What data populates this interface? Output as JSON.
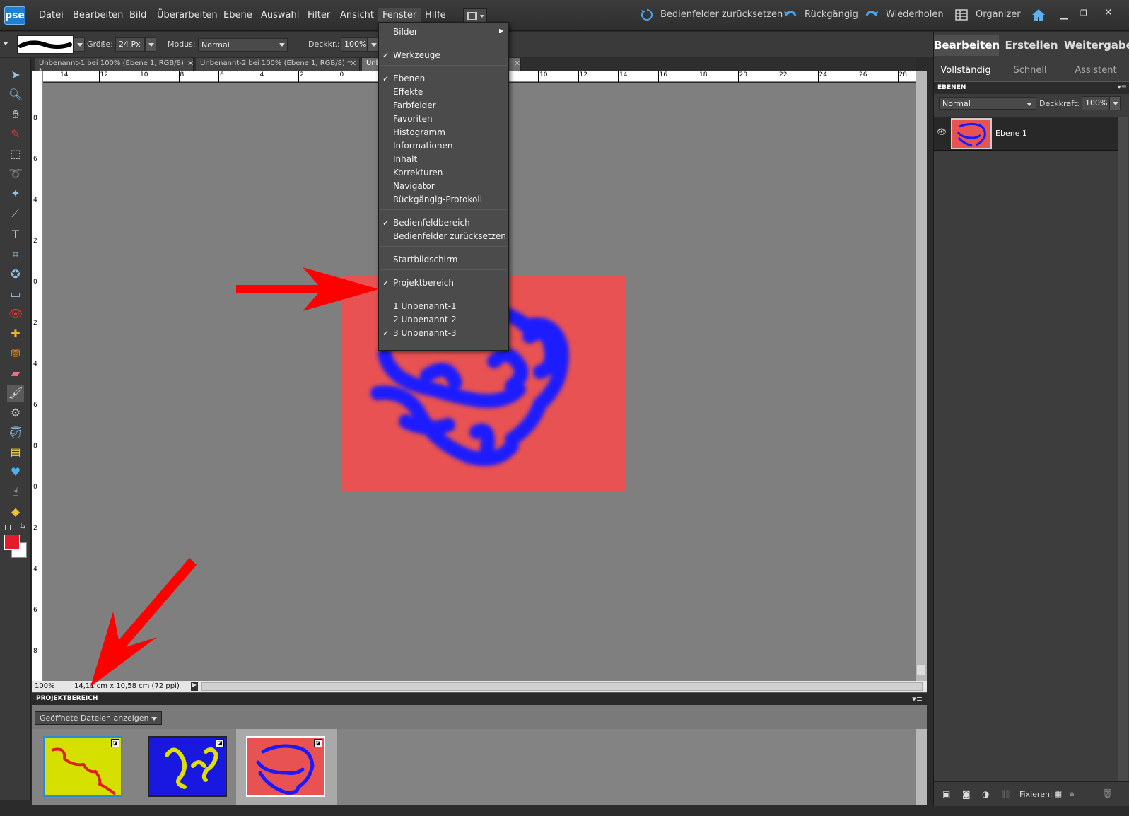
{
  "app": {
    "logo_text": "pse"
  },
  "menubar": {
    "items": [
      "Datei",
      "Bearbeiten",
      "Bild",
      "Überarbeiten",
      "Ebene",
      "Auswahl",
      "Filter",
      "Ansicht",
      "Fenster",
      "Hilfe"
    ],
    "active": "Fenster",
    "reset_panels": "Bedienfelder zurücksetzen",
    "undo": "Rückgängig",
    "redo": "Wiederholen",
    "organizer": "Organizer"
  },
  "options": {
    "size_label": "Größe:",
    "size_value": "24 Px",
    "mode_label": "Modus:",
    "mode_value": "Normal",
    "opacity_label": "Deckkr.:",
    "opacity_value": "100%"
  },
  "tabs": [
    {
      "label": "Unbenannt-1 bei 100% (Ebene 1, RGB/8) *"
    },
    {
      "label": "Unbenannt-2 bei 100% (Ebene 1, RGB/8) *"
    },
    {
      "label": "Unb"
    }
  ],
  "ruler_top": [
    "14",
    "12",
    "10",
    "8",
    "6",
    "4",
    "2",
    "0",
    "2",
    "4",
    "6",
    "8",
    "10",
    "12",
    "14",
    "16",
    "18",
    "20",
    "22",
    "24",
    "26",
    "28"
  ],
  "ruler_left": [
    "8",
    "6",
    "4",
    "2",
    "0",
    "2",
    "4",
    "6",
    "8",
    "0",
    "2",
    "4",
    "6",
    "8"
  ],
  "status": {
    "zoom": "100%",
    "doc_size": "14,11 cm x 10,58 cm (72 ppi)"
  },
  "project": {
    "title": "PROJEKTBEREICH",
    "filter": "Geöffnete Dateien anzeigen"
  },
  "right": {
    "tabs": [
      "Bearbeiten",
      "Erstellen",
      "Weitergabe"
    ],
    "subtabs": [
      "Vollständig",
      "Schnell",
      "Assistent"
    ],
    "layers_header": "EBENEN",
    "blend_mode": "Normal",
    "opacity_label": "Deckkraft:",
    "opacity_value": "100%",
    "layer_name": "Ebene 1",
    "lock_label": "Fixieren:"
  },
  "fenster_menu": {
    "groups": [
      [
        {
          "label": "Bilder",
          "check": false,
          "submenu": true
        }
      ],
      [
        {
          "label": "Werkzeuge",
          "check": true
        }
      ],
      [
        {
          "label": "Ebenen",
          "check": true
        },
        {
          "label": "Effekte",
          "check": false
        },
        {
          "label": "Farbfelder",
          "check": false
        },
        {
          "label": "Favoriten",
          "check": false
        },
        {
          "label": "Histogramm",
          "check": false
        },
        {
          "label": "Informationen",
          "check": false
        },
        {
          "label": "Inhalt",
          "check": false
        },
        {
          "label": "Korrekturen",
          "check": false
        },
        {
          "label": "Navigator",
          "check": false
        },
        {
          "label": "Rückgängig-Protokoll",
          "check": false
        }
      ],
      [
        {
          "label": "Bedienfeldbereich",
          "check": true
        },
        {
          "label": "Bedienfelder zurücksetzen",
          "check": false
        }
      ],
      [
        {
          "label": "Startbildschirm",
          "check": false
        }
      ],
      [
        {
          "label": "Projektbereich",
          "check": true
        }
      ],
      [
        {
          "label": "1 Unbenannt-1",
          "check": false
        },
        {
          "label": "2 Unbenannt-2",
          "check": false
        },
        {
          "label": "3 Unbenannt-3",
          "check": true
        }
      ]
    ]
  },
  "colors": {
    "canvas_red": "#e85252",
    "stroke_blue": "#1a1aff",
    "yellow": "#d8e000",
    "accent": "#1f7fd0",
    "arrow": "#ff0000"
  }
}
